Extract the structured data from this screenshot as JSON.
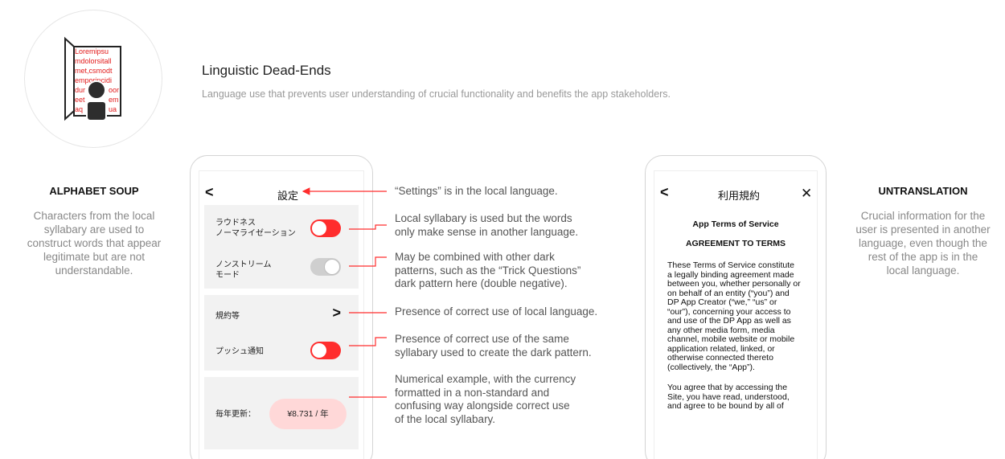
{
  "header": {
    "icon_text_lines": [
      "Loremipsu",
      "mdolorsitall",
      "met,csmodt",
      "emporincidi",
      "dur",
      "oor",
      "eet",
      "em",
      "aq",
      "ua"
    ],
    "title": "Linguistic Dead-Ends",
    "subtitle": "Language use that prevents user understanding of crucial functionality and benefits the app stakeholders."
  },
  "left_panel": {
    "title": "ALPHABET SOUP",
    "description": [
      "Characters from the local",
      "syllabary are used to",
      "construct words that appear",
      "legitimate but are not",
      "understandable."
    ]
  },
  "right_panel": {
    "title": "UNTRANSLATION",
    "description": [
      "Crucial information for the",
      "user is presented in another",
      "language, even though the",
      "rest of the app is in the",
      "local language."
    ]
  },
  "settings_phone": {
    "back_glyph": "<",
    "title": "設定",
    "rows": [
      {
        "label": [
          "ラウドネス",
          "ノーマライゼーション"
        ],
        "toggle": "on"
      },
      {
        "label": [
          "ノンストリーム",
          "モード"
        ],
        "toggle": "off"
      },
      {
        "label": [
          "規約等"
        ],
        "chevron": ">"
      },
      {
        "label": [
          "プッシュ通知"
        ],
        "toggle": "on"
      },
      {
        "label": [
          "毎年更新："
        ],
        "price": "¥8.731 / 年"
      }
    ]
  },
  "terms_phone": {
    "back_glyph": "<",
    "title": "利用規約",
    "close_glyph": "✕",
    "heading1": "App Terms of Service",
    "heading2": "AGREEMENT TO TERMS",
    "paragraph1": [
      "These Terms of Service constitute",
      "a legally binding agreement made",
      "between you, whether personally or",
      "on behalf of an entity (“you”) and",
      "DP App Creator (“we,” “us” or",
      "“our”), concerning your access to",
      "and use of the DP App as well as",
      "any other media form, media",
      "channel, mobile website or mobile",
      "application related, linked, or",
      "otherwise connected thereto",
      "(collectively, the “App”)."
    ],
    "paragraph2": [
      "You agree that by accessing the",
      "Site, you have read, understood,",
      "and agree to be bound by all of"
    ]
  },
  "annotations": [
    {
      "lines": [
        "“Settings” is in the local language."
      ]
    },
    {
      "lines": [
        "Local syllabary is used but the words",
        "only make sense in another language."
      ]
    },
    {
      "lines": [
        "May be combined with other dark",
        "patterns, such as the “Trick Questions”",
        "dark pattern here (double negative)."
      ]
    },
    {
      "lines": [
        "Presence of correct use of local language."
      ]
    },
    {
      "lines": [
        "Presence of correct use of the same",
        "syllabary used to create the dark pattern."
      ]
    },
    {
      "lines": [
        "Numerical example, with the currency",
        "formatted in a non-standard and",
        "confusing way alongside correct use",
        "of the local syllabary."
      ]
    }
  ],
  "colors": {
    "accent_red": "#ff2d2d",
    "price_bg": "#ffd8d8",
    "row_bg": "#f2f2f2",
    "muted_text": "#888888"
  }
}
